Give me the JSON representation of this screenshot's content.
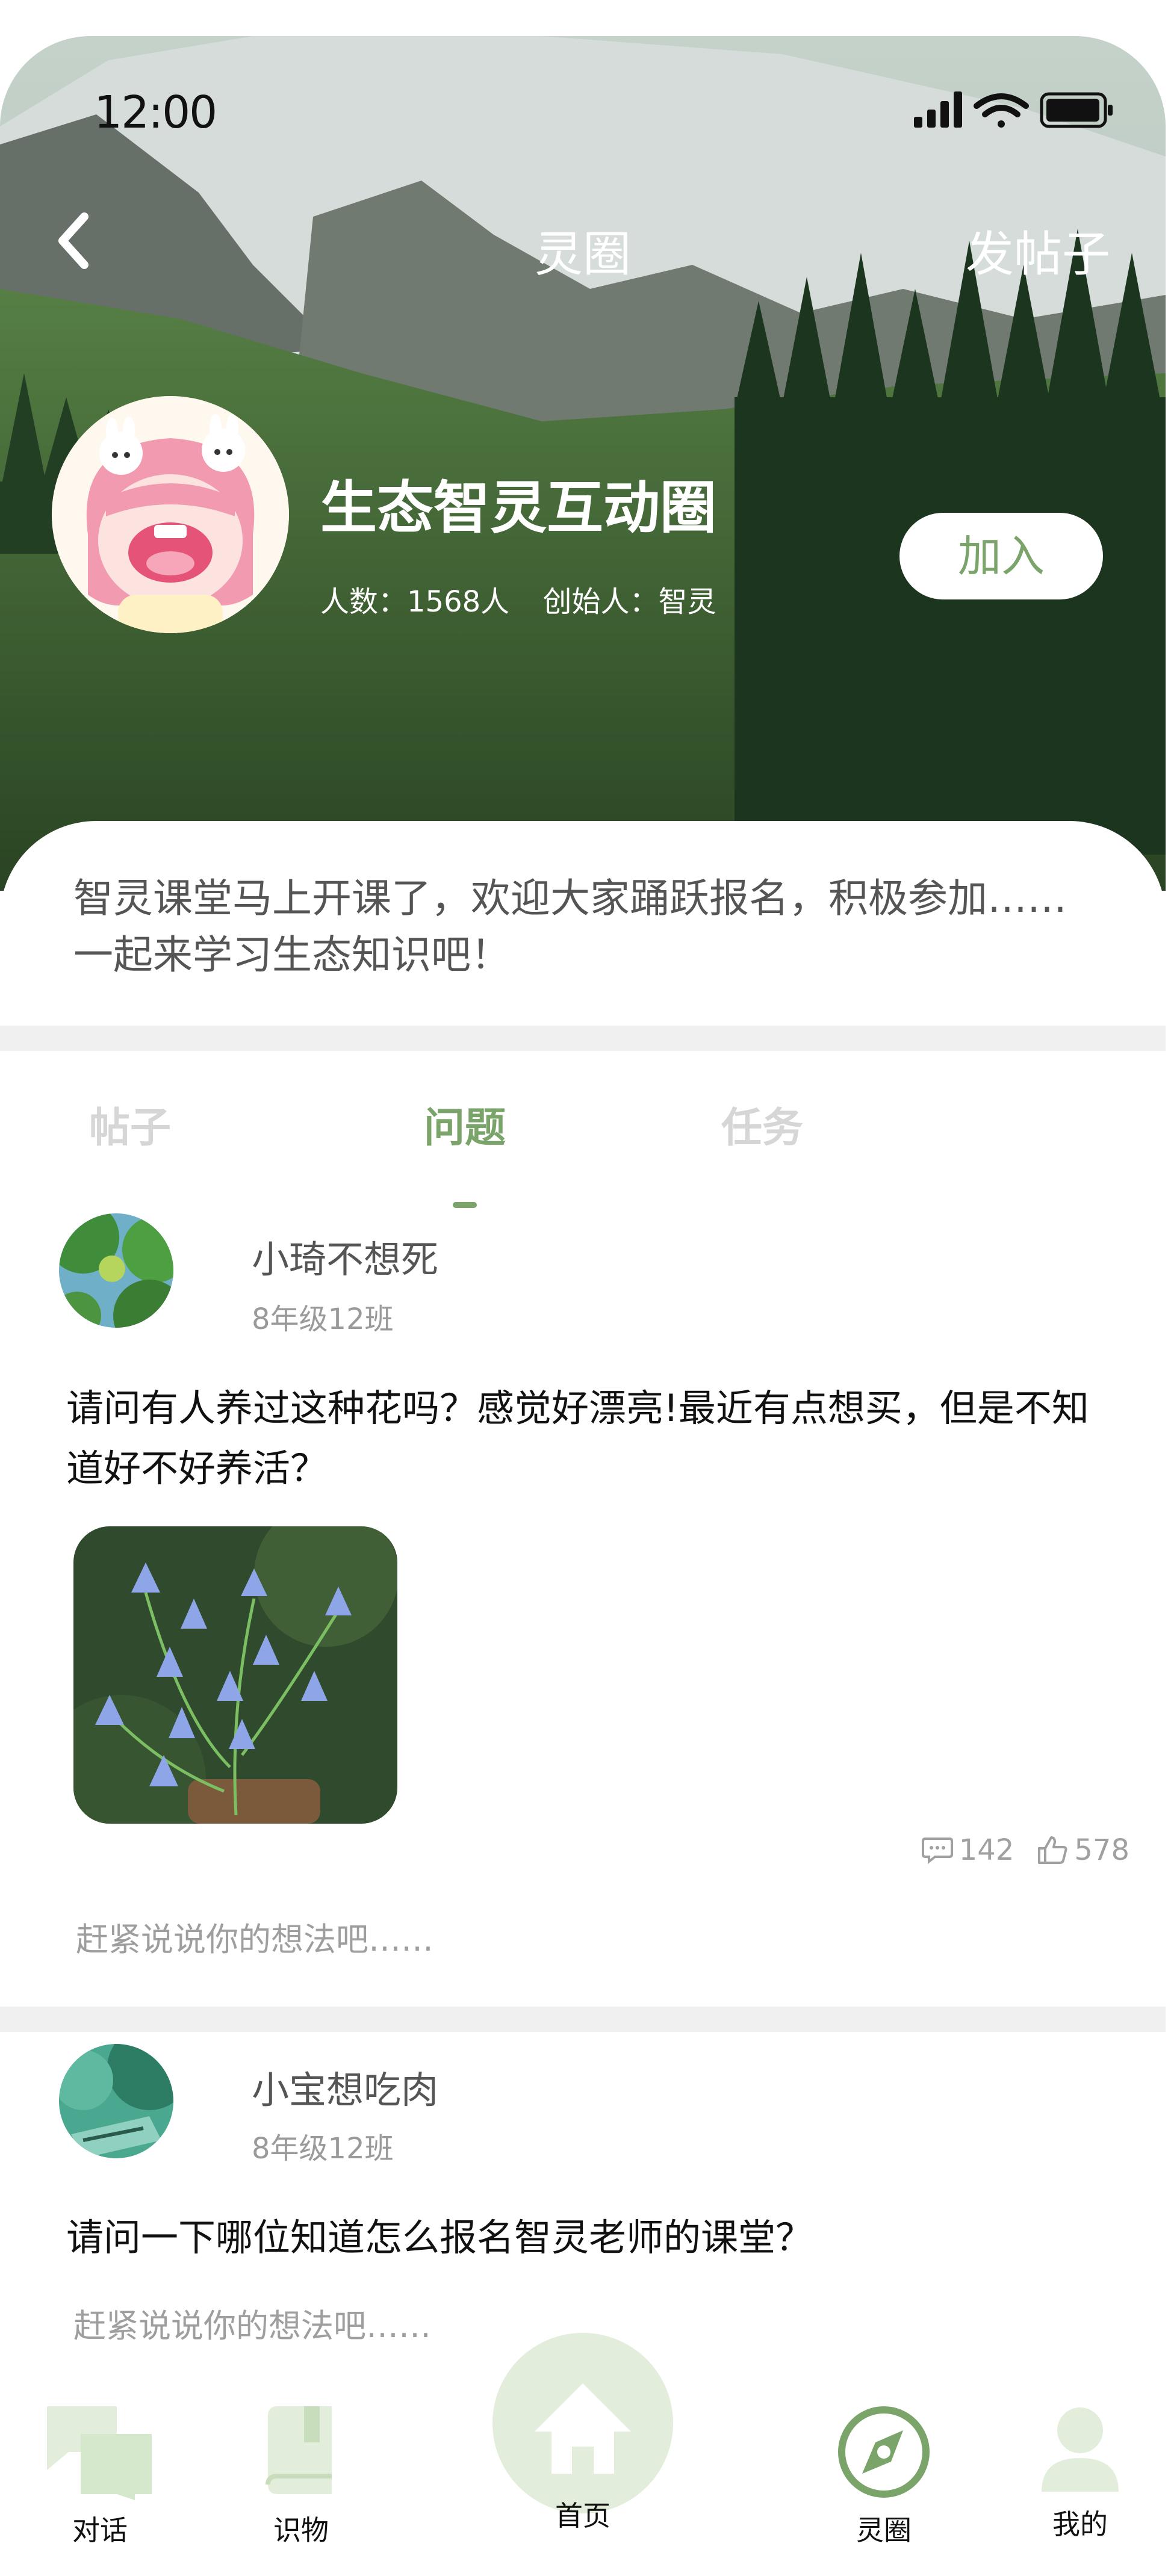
{
  "status_bar": {
    "time": "12:00"
  },
  "nav": {
    "title": "灵圈",
    "post_action": "发帖子"
  },
  "circle": {
    "name": "生态智灵互动圈",
    "member_count": "人数：1568人",
    "founder": "创始人：智灵",
    "join_label": "加入",
    "intro_line1": "智灵课堂马上开课了，欢迎大家踊跃报名，积极参加……",
    "intro_line2": "一起来学习生态知识吧！"
  },
  "tabs": [
    {
      "label": "帖子",
      "active": false
    },
    {
      "label": "问题",
      "active": true
    },
    {
      "label": "任务",
      "active": false
    }
  ],
  "posts": [
    {
      "user": "小琦不想死",
      "class": "8年级12班",
      "text_line1": "请问有人养过这种花吗？感觉好漂亮!最近有点想买，但是不知",
      "text_line2": "道好不好养活？",
      "comments": "142",
      "likes": "578",
      "comment_hint": "赶紧说说你的想法吧……"
    },
    {
      "user": "小宝想吃肉",
      "class": "8年级12班",
      "text_line1": "请问一下哪位知道怎么报名智灵老师的课堂？",
      "comment_hint": "赶紧说说你的想法吧……"
    }
  ],
  "bottom_nav": [
    {
      "label": "对话",
      "icon": "chat-icon"
    },
    {
      "label": "识物",
      "icon": "book-icon"
    },
    {
      "label": "首页",
      "icon": "home-icon"
    },
    {
      "label": "灵圈",
      "icon": "compass-icon"
    },
    {
      "label": "我的",
      "icon": "user-icon"
    }
  ],
  "colors": {
    "accent": "#7aa46a",
    "accent_light": "#e2eedb",
    "divider": "#f0f0f0"
  }
}
